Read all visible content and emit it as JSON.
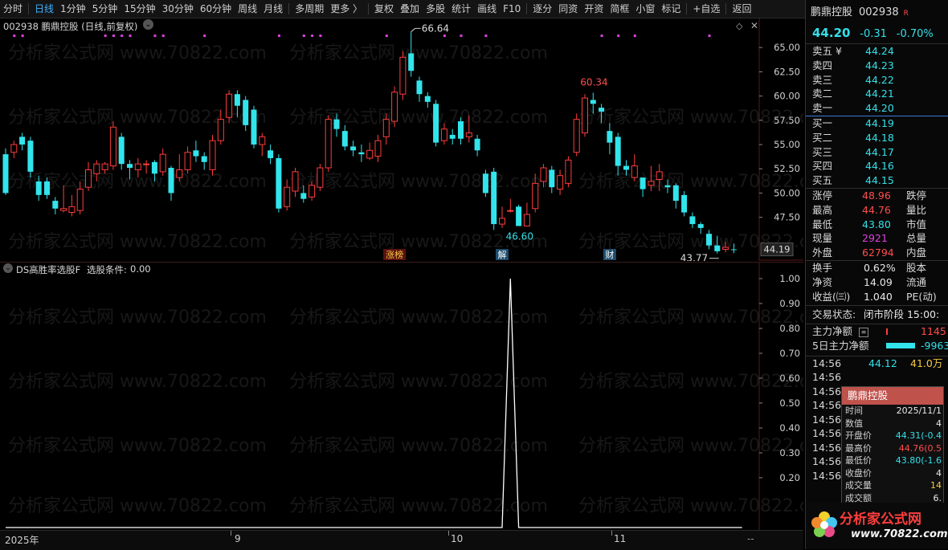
{
  "toolbar": {
    "items": [
      "分时",
      "日线",
      "1分钟",
      "5分钟",
      "15分钟",
      "30分钟",
      "60分钟",
      "周线",
      "月线",
      "多周期",
      "更多 〉",
      "复权",
      "叠加",
      "多股",
      "统计",
      "画线",
      "F10",
      "逐分",
      "同资",
      "开资",
      "简框",
      "小窗",
      "标记",
      "+自选",
      "返回"
    ],
    "active": "日线"
  },
  "price_pane": {
    "title": "002938 鹏鼎控股 (日线,前复权)",
    "high_label": "66.64",
    "low_label": "46.60",
    "peak2_label": "60.34",
    "last_low_label": "43.77",
    "current_price_tag": "44.19",
    "events": [
      "涨榜",
      "解",
      "财"
    ]
  },
  "indicator_pane": {
    "title": "DS高胜率选股F",
    "condition_label": "选股条件:",
    "condition_value": "0.00"
  },
  "x_axis": {
    "labels": [
      "2025年",
      "9",
      "10",
      "11"
    ],
    "right_button": "--"
  },
  "chart_data": [
    {
      "type": "candlestick",
      "title": "002938 鹏鼎控股 (日线,前复权)",
      "ylim": [
        43.0,
        68.0
      ],
      "y_ticks": [
        47.5,
        50.0,
        52.5,
        55.0,
        57.5,
        60.0,
        62.5,
        65.0
      ],
      "annotations": {
        "max": 66.64,
        "min_mid": 46.6,
        "peak2": 60.34,
        "min_end": 43.77
      },
      "candles": [
        [
          54.0,
          50.0,
          54.6,
          49.8
        ],
        [
          54.2,
          55.0,
          55.4,
          53.6
        ],
        [
          55.8,
          55.0,
          56.2,
          54.4
        ],
        [
          55.4,
          52.2,
          55.8,
          51.6
        ],
        [
          51.2,
          49.8,
          51.8,
          49.2
        ],
        [
          51.2,
          49.8,
          51.6,
          49.4
        ],
        [
          49.2,
          48.4,
          49.6,
          47.8
        ],
        [
          48.2,
          48.4,
          50.8,
          48.0
        ],
        [
          48.0,
          48.6,
          49.8,
          47.6
        ],
        [
          48.2,
          50.4,
          51.2,
          47.8
        ],
        [
          50.6,
          52.4,
          53.2,
          50.2
        ],
        [
          52.0,
          53.0,
          53.4,
          51.2
        ],
        [
          52.4,
          53.0,
          53.2,
          52.0
        ],
        [
          52.8,
          56.8,
          57.4,
          52.4
        ],
        [
          55.8,
          53.0,
          56.2,
          52.4
        ],
        [
          53.0,
          52.6,
          53.4,
          51.4
        ],
        [
          52.4,
          53.0,
          53.6,
          51.6
        ],
        [
          53.0,
          53.0,
          53.4,
          52.0
        ],
        [
          53.2,
          52.0,
          53.4,
          51.2
        ],
        [
          52.2,
          54.0,
          54.6,
          51.8
        ],
        [
          52.6,
          50.0,
          52.8,
          49.2
        ],
        [
          51.6,
          52.4,
          54.0,
          51.2
        ],
        [
          52.4,
          54.2,
          54.8,
          52.0
        ],
        [
          54.4,
          53.8,
          55.4,
          53.2
        ],
        [
          53.8,
          53.2,
          54.2,
          52.4
        ],
        [
          52.4,
          55.4,
          56.0,
          51.8
        ],
        [
          55.4,
          57.6,
          58.6,
          55.0
        ],
        [
          57.8,
          60.2,
          60.6,
          57.2
        ],
        [
          60.2,
          59.0,
          60.6,
          57.8
        ],
        [
          59.6,
          57.0,
          60.0,
          56.4
        ],
        [
          58.6,
          55.0,
          59.0,
          54.6
        ],
        [
          55.0,
          55.8,
          56.2,
          53.8
        ],
        [
          54.4,
          53.6,
          55.0,
          53.0
        ],
        [
          53.6,
          48.4,
          54.0,
          48.0
        ],
        [
          48.6,
          50.6,
          51.4,
          48.2
        ],
        [
          50.2,
          52.2,
          52.6,
          49.6
        ],
        [
          50.0,
          49.4,
          50.8,
          49.0
        ],
        [
          49.6,
          50.8,
          51.2,
          49.2
        ],
        [
          50.6,
          52.6,
          53.0,
          50.2
        ],
        [
          52.6,
          57.6,
          58.0,
          52.2
        ],
        [
          57.6,
          56.6,
          58.2,
          55.8
        ],
        [
          56.4,
          54.8,
          57.0,
          54.4
        ],
        [
          54.8,
          54.4,
          55.4,
          53.8
        ],
        [
          54.2,
          54.0,
          55.0,
          53.2
        ],
        [
          53.6,
          54.4,
          55.2,
          53.4
        ],
        [
          53.8,
          55.4,
          56.0,
          53.2
        ],
        [
          55.8,
          57.6,
          58.2,
          55.0
        ],
        [
          57.4,
          60.4,
          61.0,
          56.8
        ],
        [
          60.2,
          64.0,
          64.6,
          59.6
        ],
        [
          64.4,
          62.6,
          66.64,
          62.0
        ],
        [
          61.6,
          60.2,
          62.0,
          59.4
        ],
        [
          60.0,
          59.4,
          60.4,
          58.8
        ],
        [
          59.2,
          55.2,
          59.6,
          54.8
        ],
        [
          55.4,
          56.6,
          57.2,
          55.0
        ],
        [
          56.0,
          55.6,
          56.6,
          55.0
        ],
        [
          57.4,
          55.6,
          57.8,
          55.0
        ],
        [
          55.8,
          56.2,
          58.0,
          55.2
        ],
        [
          55.6,
          54.4,
          56.0,
          53.8
        ],
        [
          52.0,
          50.0,
          52.4,
          49.6
        ],
        [
          52.2,
          46.8,
          52.6,
          46.2
        ],
        [
          46.8,
          47.4,
          48.6,
          46.4
        ],
        [
          48.2,
          48.2,
          49.4,
          48.0
        ],
        [
          48.6,
          46.6,
          48.8,
          46.6
        ],
        [
          46.6,
          47.8,
          49.0,
          46.8
        ],
        [
          48.4,
          51.0,
          52.0,
          48.0
        ],
        [
          51.2,
          52.6,
          53.0,
          50.6
        ],
        [
          52.4,
          50.6,
          52.8,
          50.0
        ],
        [
          50.4,
          51.8,
          52.4,
          49.8
        ],
        [
          51.0,
          53.4,
          53.8,
          50.6
        ],
        [
          54.2,
          57.6,
          58.2,
          53.8
        ],
        [
          56.2,
          59.8,
          60.2,
          55.8
        ],
        [
          59.6,
          59.2,
          60.34,
          58.2
        ],
        [
          58.8,
          58.4,
          59.2,
          57.2
        ],
        [
          56.4,
          55.2,
          57.2,
          54.0
        ],
        [
          55.8,
          52.8,
          56.2,
          51.8
        ],
        [
          52.8,
          52.4,
          53.4,
          51.8
        ],
        [
          51.6,
          52.8,
          54.0,
          51.2
        ],
        [
          51.6,
          50.4,
          51.6,
          49.6
        ],
        [
          50.8,
          51.2,
          52.8,
          50.2
        ],
        [
          51.4,
          52.2,
          53.0,
          50.2
        ],
        [
          50.8,
          50.6,
          51.4,
          50.0
        ],
        [
          50.8,
          49.2,
          51.0,
          48.4
        ],
        [
          49.8,
          48.0,
          50.2,
          47.6
        ],
        [
          47.6,
          46.8,
          48.0,
          46.4
        ],
        [
          46.8,
          46.4,
          47.0,
          45.8
        ],
        [
          45.8,
          44.6,
          46.2,
          44.2
        ],
        [
          44.6,
          44.0,
          45.6,
          43.77
        ],
        [
          44.2,
          44.4,
          45.0,
          43.9
        ],
        [
          44.2,
          44.19,
          44.8,
          43.8
        ]
      ],
      "candle_fields": [
        "open",
        "close",
        "high",
        "low"
      ]
    },
    {
      "type": "line",
      "title": "DS高胜率选股F",
      "ylim": [
        0,
        1.0
      ],
      "y_ticks": [
        0.2,
        0.3,
        0.4,
        0.5,
        0.6,
        0.7,
        0.8,
        0.9,
        1.0
      ],
      "x_count": 90,
      "spike_index": 61,
      "values_note": "0 everywhere except 1.00 at spike_index"
    }
  ],
  "quote": {
    "name": "鹏鼎控股",
    "code": "002938",
    "tag": "R",
    "last": "44.20",
    "change": "-0.31",
    "change_pct": "-0.70%",
    "asks": [
      {
        "label": "卖五 ¥",
        "price": "44.24"
      },
      {
        "label": "卖四",
        "price": "44.23"
      },
      {
        "label": "卖三",
        "price": "44.22"
      },
      {
        "label": "卖二",
        "price": "44.21"
      },
      {
        "label": "卖一",
        "price": "44.20"
      }
    ],
    "bids": [
      {
        "label": "买一",
        "price": "44.19"
      },
      {
        "label": "买二",
        "price": "44.18"
      },
      {
        "label": "买三",
        "price": "44.17"
      },
      {
        "label": "买四",
        "price": "44.16"
      },
      {
        "label": "买五",
        "price": "44.15"
      }
    ],
    "stats": [
      {
        "l": "涨停",
        "v": "48.96",
        "c": "red",
        "l2": "跌停"
      },
      {
        "l": "最高",
        "v": "44.76",
        "c": "red",
        "l2": "量比"
      },
      {
        "l": "最低",
        "v": "43.80",
        "c": "cyan",
        "l2": "市值"
      },
      {
        "l": "现量",
        "v": "2921",
        "c": "magenta",
        "l2": "总量"
      },
      {
        "l": "外盘",
        "v": "62794",
        "c": "red",
        "l2": "内盘"
      }
    ],
    "stats2": [
      {
        "l": "换手",
        "v": "0.62%",
        "l2": "股本"
      },
      {
        "l": "净资",
        "v": "14.09",
        "l2": "流通"
      },
      {
        "l": "收益(㈢)",
        "v": "1.040",
        "l2": "PE(动)"
      }
    ],
    "trade_status_label": "交易状态:",
    "trade_status_value": "闭市阶段 15:00:",
    "main_net_label": "主力净额",
    "main_net_value": "1145",
    "main_net5_label": "5日主力净额",
    "main_net5_value": "-9963",
    "ticks": [
      {
        "t": "14:56",
        "p": "44.12",
        "v": "41.0万"
      },
      {
        "t": "14:56"
      },
      {
        "t": "14:56"
      },
      {
        "t": "14:56"
      },
      {
        "t": "14:56"
      },
      {
        "t": "14:56"
      },
      {
        "t": "14:56"
      },
      {
        "t": "14:56"
      },
      {
        "t": "14:56"
      }
    ]
  },
  "tooltip": {
    "header": "鹏鼎控股",
    "rows": [
      {
        "l": "时间",
        "v": "2025/11/1",
        "c": "white"
      },
      {
        "l": "数值",
        "v": "4",
        "c": "white"
      },
      {
        "l": "开盘价",
        "v": "44.31(-0.4",
        "c": "cyan"
      },
      {
        "l": "最高价",
        "v": "44.76(0.5",
        "c": "red"
      },
      {
        "l": "最低价",
        "v": "43.80(-1.6",
        "c": "cyan"
      },
      {
        "l": "收盘价",
        "v": "4",
        "c": "white"
      },
      {
        "l": "成交量",
        "v": "14",
        "c": "yellow"
      },
      {
        "l": "成交额",
        "v": "6.",
        "c": "white"
      }
    ]
  },
  "watermark": "分析家公式网 www.70822.com",
  "logo": {
    "text": "分析家公式网",
    "url": "www.70822.com"
  },
  "colors": {
    "up": "#ff3d3d",
    "down": "#32e4ec",
    "bg": "#000000",
    "accent": "#3fb0ff"
  }
}
